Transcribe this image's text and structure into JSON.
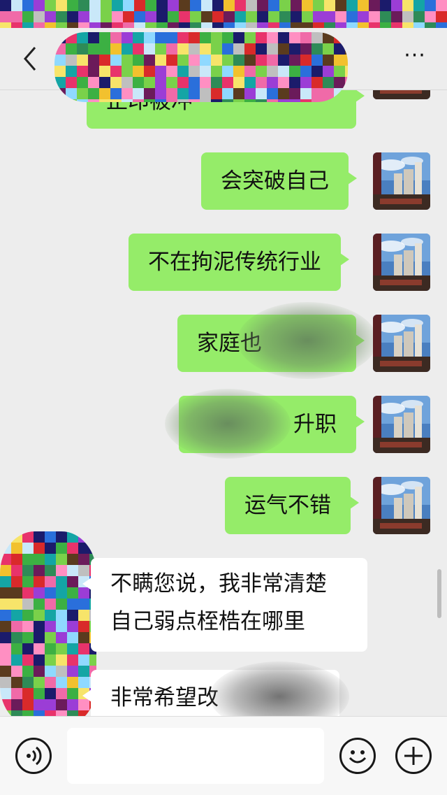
{
  "nav": {
    "back_icon": "chevron-left-icon",
    "more_label": "···"
  },
  "messages": [
    {
      "side": "right",
      "text": "正印被冲"
    },
    {
      "side": "right",
      "text": "会突破自己"
    },
    {
      "side": "right",
      "text": "不在拘泥传统行业"
    },
    {
      "side": "right",
      "text": "家庭也"
    },
    {
      "side": "right",
      "text": "升职"
    },
    {
      "side": "right",
      "text": "运气不错"
    },
    {
      "side": "left",
      "text_line1": "不瞒您说，我非常清楚",
      "text_line2": "自己弱点桎梏在哪里"
    },
    {
      "side": "left",
      "text": "非常希望改"
    }
  ],
  "input": {
    "placeholder": "",
    "value": ""
  },
  "icons": {
    "voice": "voice-icon",
    "emoji": "emoji-icon",
    "plus": "plus-icon"
  },
  "colors": {
    "my_bubble": "#95ec69",
    "other_bubble": "#ffffff",
    "background": "#ededed"
  }
}
